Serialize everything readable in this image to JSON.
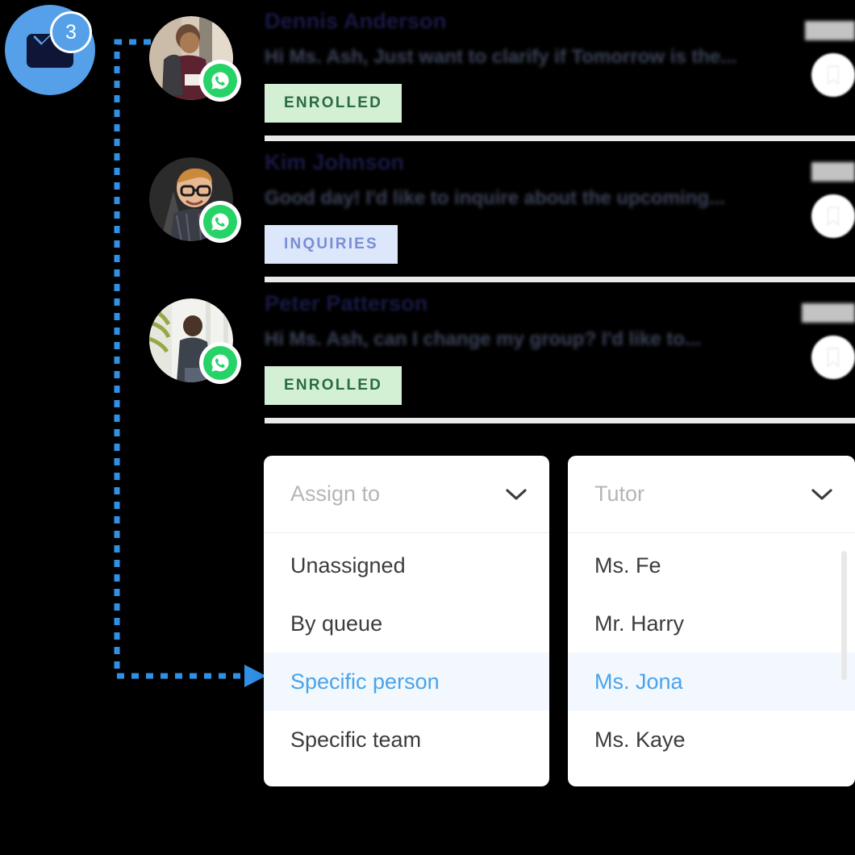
{
  "mail_badge": {
    "icon": "envelope-icon",
    "count": "3",
    "circle_color": "#55a0e8",
    "envelope_color": "#0f1536"
  },
  "connector": {
    "style": "dashed-elbow-arrow",
    "color": "#2f90e6",
    "arrow": "arrow-right"
  },
  "messages": [
    {
      "name": "Dennis Anderson",
      "preview": "Hi Ms. Ash, Just want to clarify if Tomorrow is the...",
      "badge": "ENROLLED",
      "badge_type": "enrolled",
      "badge_bg": "#d4f0d4",
      "badge_fg": "#2a6b41",
      "channel": "whatsapp-icon",
      "avatar": "avatar-man-with-backpack",
      "flag": "bookmark-icon"
    },
    {
      "name": "Kim Johnson",
      "preview": "Good day! I'd like to inquire about the upcoming...",
      "badge": "INQUIRIES",
      "badge_type": "inquiries",
      "badge_bg": "#dce7fb",
      "badge_fg": "#7b8dd4",
      "channel": "whatsapp-icon",
      "avatar": "avatar-man-with-glasses",
      "flag": "bookmark-icon"
    },
    {
      "name": "Peter Patterson",
      "preview": "Hi Ms. Ash, can I change my group? I'd like to...",
      "badge": "ENROLLED",
      "badge_type": "enrolled",
      "badge_bg": "#d4f0d4",
      "badge_fg": "#2a6b41",
      "channel": "whatsapp-icon",
      "avatar": "avatar-man-by-window",
      "flag": "bookmark-icon"
    }
  ],
  "dropdown_assign": {
    "placeholder": "Assign to",
    "chevron": "chevron-down-icon",
    "selected": "Specific person",
    "options": [
      "Unassigned",
      "By queue",
      "Specific person",
      "Specific team"
    ]
  },
  "dropdown_tutor": {
    "placeholder": "Tutor",
    "chevron": "chevron-down-icon",
    "selected": "Ms. Jona",
    "has_scrollbar": true,
    "options": [
      "Ms. Fe",
      "Mr. Harry",
      "Ms. Jona",
      "Ms. Kaye"
    ]
  },
  "colors": {
    "accent_blue": "#4aa3ea",
    "highlight_row": "#f2f8fe",
    "whatsapp_green": "#25D366",
    "name_navy": "#181845"
  }
}
